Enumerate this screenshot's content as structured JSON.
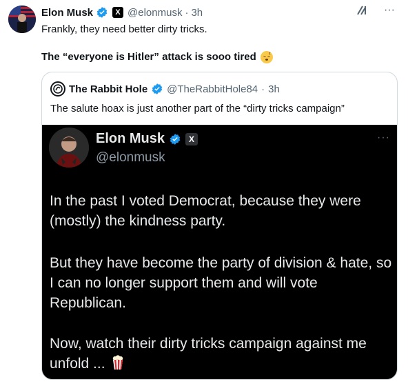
{
  "post": {
    "author_name": "Elon Musk",
    "author_handle": "@elonmusk",
    "separator": "·",
    "time": "3h",
    "line1": "Frankly, they need better dirty tricks.",
    "line2": "The “everyone is Hitler” attack is sooo tired",
    "line2_emoji": "sleepy-face-emoji",
    "verified_color": "#1d9bf0",
    "actions": {
      "grok_icon": "grok-icon",
      "more_icon": "more-icon",
      "more_label": "···"
    }
  },
  "quote": {
    "author_name": "The Rabbit Hole",
    "author_handle": "@TheRabbitHole84",
    "separator": "·",
    "time": "3h",
    "text": "The salute hoax is just another part of the “dirty tricks campaign”",
    "media": {
      "name": "Elon Musk",
      "handle": "@elonmusk",
      "more_label": "···",
      "para1": "In the past I voted Democrat, because they were (mostly) the kindness party.",
      "para2": "But they have become the party of division & hate, so I can no longer support them and will vote Republican.",
      "para3": "Now, watch their dirty tricks campaign against me unfold ...",
      "para3_emoji": "popcorn-emoji"
    }
  }
}
